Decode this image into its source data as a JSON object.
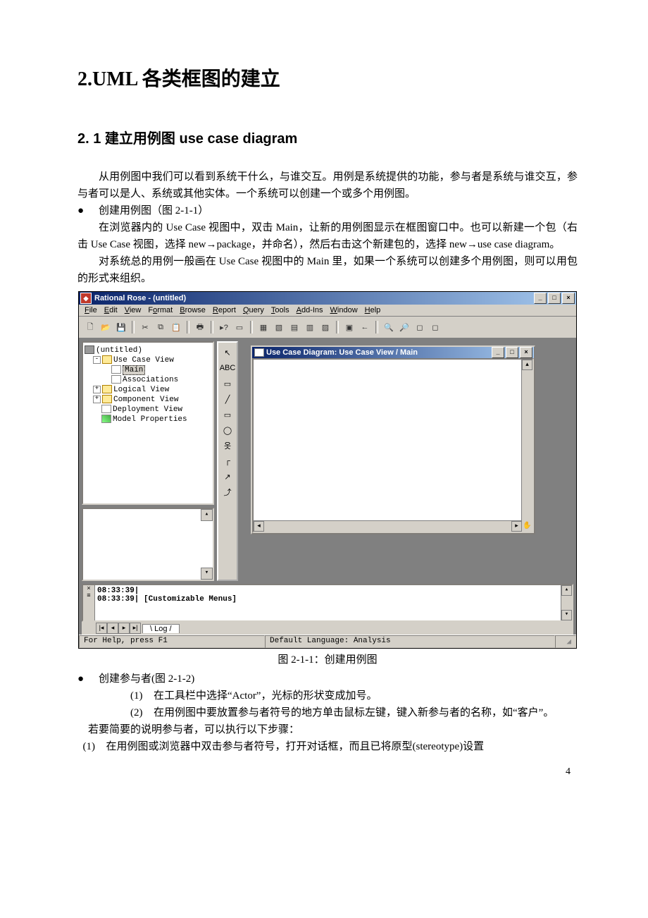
{
  "doc": {
    "heading1": "2.UML 各类框图的建立",
    "heading2": "2. 1 建立用例图 use case diagram",
    "para1": "从用例图中我们可以看到系统干什么，与谁交互。用例是系统提供的功能，参与者是系统与谁交互，参与者可以是人、系统或其他实体。一个系统可以创建一个或多个用例图。",
    "bullet1": "创建用例图（图 2-1-1）",
    "para2": "在浏览器内的 Use Case 视图中，双击 Main，让新的用例图显示在框图窗口中。也可以新建一个包（右击 Use Case 视图，选择 new→package，并命名），然后右击这个新建包的，选择 new→use case diagram。",
    "para3": "对系统总的用例一般画在 Use Case 视图中的 Main 里，如果一个系统可以创建多个用例图，则可以用包的形式来组织。",
    "figcap": "图 2-1-1：创建用例图",
    "bullet2": "创建参与者(图 2-1-2)",
    "step1_num": "(1)",
    "step1": "在工具栏中选择“Actor”，光标的形状变成加号。",
    "step2_num": "(2)",
    "step2": "在用例图中要放置参与者符号的地方单击鼠标左键，键入新参与者的名称，如“客户”。",
    "para4": "若要简要的说明参与者，可以执行以下步骤：",
    "para5_num": "(1)",
    "para5": "在用例图或浏览器中双击参与者符号，打开对话框，而且已将原型(stereotype)设置",
    "pagenum": "4",
    "bullet_char": "●"
  },
  "rose": {
    "title": "Rational Rose - (untitled)",
    "menus": [
      "File",
      "Edit",
      "View",
      "Format",
      "Browse",
      "Report",
      "Query",
      "Tools",
      "Add-Ins",
      "Window",
      "Help"
    ],
    "tree": {
      "root": "(untitled)",
      "usecase": "Use Case View",
      "main": "Main",
      "assoc": "Associations",
      "logical": "Logical View",
      "component": "Component View",
      "deployment": "Deployment View",
      "modelprops": "Model Properties"
    },
    "toolbox_abc": "ABC",
    "child_title": "Use Case Diagram: Use Case View / Main",
    "log_line1": "08:33:39|",
    "log_line2": "08:33:39|  [Customizable Menus]",
    "log_tab": "Log",
    "status_help": "For Help, press F1",
    "status_lang": "Default Language: Analysis"
  }
}
